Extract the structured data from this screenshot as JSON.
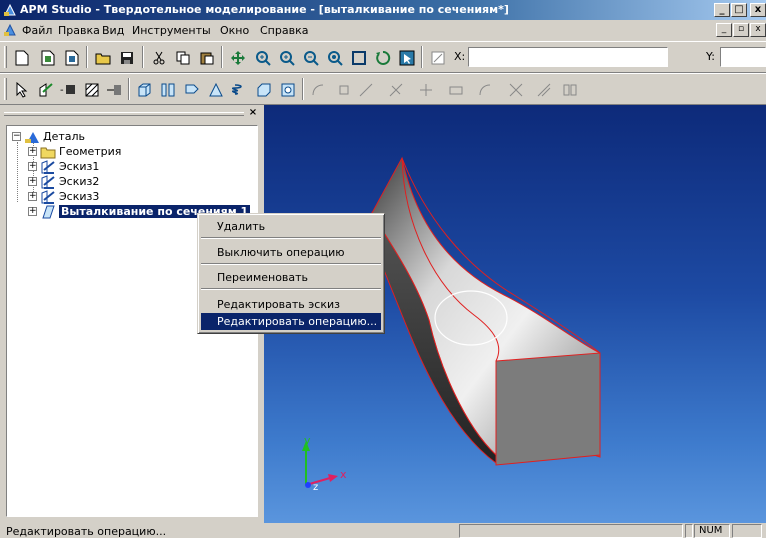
{
  "window": {
    "title": "APM Studio - Твердотельное моделирование - [выталкивание по сечениям*]",
    "minimize": "_",
    "maximize": "□",
    "close": "x"
  },
  "menu": {
    "items": [
      "Файл",
      "Правка",
      "Вид",
      "Инструменты",
      "Окно",
      "Справка"
    ],
    "mdi_minimize": "_",
    "mdi_restore": "▫",
    "mdi_close": "x"
  },
  "toolbar1": {
    "icons": [
      "new-icon",
      "open-template-icon",
      "open-assembly-icon",
      "open-folder-icon",
      "save-icon",
      "cut-icon",
      "copy-icon",
      "paste-icon",
      "pan-icon",
      "zoom-in-icon",
      "zoom-icon",
      "zoom-out-icon",
      "zoom-window-icon",
      "zoom-fit-icon",
      "rotate-icon",
      "select-icon",
      "snap-icon"
    ],
    "x_label": "X:",
    "x_value": "",
    "y_label": "Y:",
    "y_value": ""
  },
  "toolbar2": {
    "icons": [
      "pointer-icon",
      "sketch-icon",
      "box-dropdown-icon",
      "hatch-icon",
      "move-icon",
      "extrude-icon",
      "loft-icon",
      "revolve-icon",
      "sweep-icon",
      "spring-icon",
      "shell-icon",
      "boolean-icon",
      "arc-tool-icon",
      "rect-tool-icon",
      "line-tool-icon",
      "trim-tool-icon",
      "point-tool-icon",
      "rectangle-tool-icon",
      "circle-tool-icon",
      "dimension-tool-icon",
      "fillet-tool-icon",
      "mirror-tool-icon"
    ]
  },
  "panel": {
    "close": "×"
  },
  "tree": {
    "root": "Деталь",
    "items": [
      {
        "label": "Геометрия",
        "icon": "folder-icon"
      },
      {
        "label": "Эскиз1",
        "icon": "sketch-icon"
      },
      {
        "label": "Эскиз2",
        "icon": "sketch-icon"
      },
      {
        "label": "Эскиз3",
        "icon": "sketch-icon"
      },
      {
        "label": "Выталкивание по сечениям 1",
        "icon": "loft-feature-icon",
        "selected": true
      }
    ]
  },
  "context_menu": {
    "items": [
      {
        "label": "Удалить"
      },
      {
        "label": "Выключить операцию"
      },
      {
        "label": "Переименовать"
      },
      {
        "label": "Редактировать эскиз"
      },
      {
        "label": "Редактировать операцию...",
        "highlighted": true
      }
    ]
  },
  "axes": {
    "x": "x",
    "y": "y",
    "z": "z"
  },
  "statusbar": {
    "text": "Редактировать операцию...",
    "num": "NUM"
  },
  "colors": {
    "selection": "#0a246a",
    "viewport_top": "#0d2a7a",
    "viewport_bottom": "#5a95dd",
    "edge_red": "#e02020"
  }
}
